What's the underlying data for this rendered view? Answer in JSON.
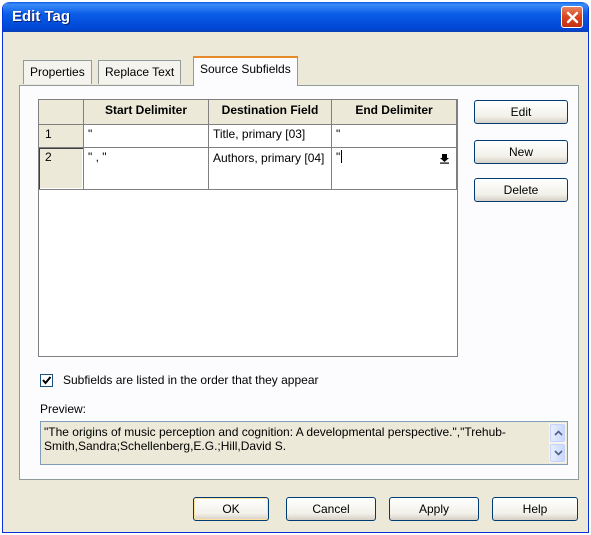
{
  "window": {
    "title": "Edit Tag"
  },
  "tabs": [
    {
      "label": "Properties"
    },
    {
      "label": "Replace Text"
    },
    {
      "label": "Source Subfields"
    }
  ],
  "grid": {
    "columns": [
      "Start Delimiter",
      "Destination Field",
      "End Delimiter"
    ],
    "rows": [
      {
        "num": "1",
        "start": "\"",
        "dest": "Title, primary [03]",
        "end": "\""
      },
      {
        "num": "2",
        "start": "\" , \"",
        "dest": "Authors, primary [04]",
        "end": "\""
      }
    ]
  },
  "side_buttons": {
    "edit": "Edit",
    "new": "New",
    "delete": "Delete"
  },
  "checkbox": {
    "label": "Subfields are listed in the order that they appear",
    "checked": true
  },
  "preview": {
    "label": "Preview:",
    "text": "\"The origins of music perception and cognition: A developmental perspective.\",\"Trehub-Smith,Sandra;Schellenberg,E.G.;Hill,David S."
  },
  "footer_buttons": {
    "ok": "OK",
    "cancel": "Cancel",
    "apply": "Apply",
    "help": "Help"
  },
  "colors": {
    "titlebar": "#0a5de7",
    "dialog_bg": "#ece9d8",
    "tab_highlight": "#e68b2c"
  }
}
